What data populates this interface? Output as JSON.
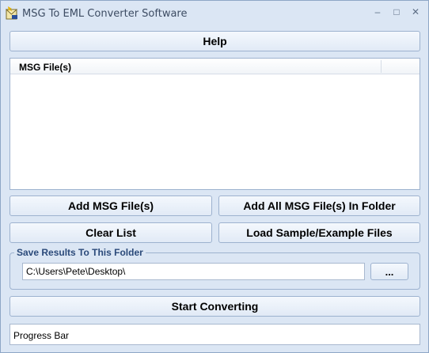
{
  "window": {
    "title": "MSG To EML Converter Software",
    "minimize_glyph": "–",
    "maximize_glyph": "□",
    "close_glyph": "✕"
  },
  "buttons": {
    "help": "Help",
    "add_files": "Add MSG File(s)",
    "add_folder": "Add All MSG File(s) In Folder",
    "clear_list": "Clear List",
    "load_samples": "Load Sample/Example Files",
    "browse": "...",
    "start": "Start Converting"
  },
  "file_list": {
    "column_header": "MSG File(s)"
  },
  "output": {
    "group_label": "Save Results To This Folder",
    "folder_path": "C:\\Users\\Pete\\Desktop\\"
  },
  "progress": {
    "label": "Progress Bar"
  },
  "icons": {
    "app": "envelope-with-arrow-icon"
  }
}
